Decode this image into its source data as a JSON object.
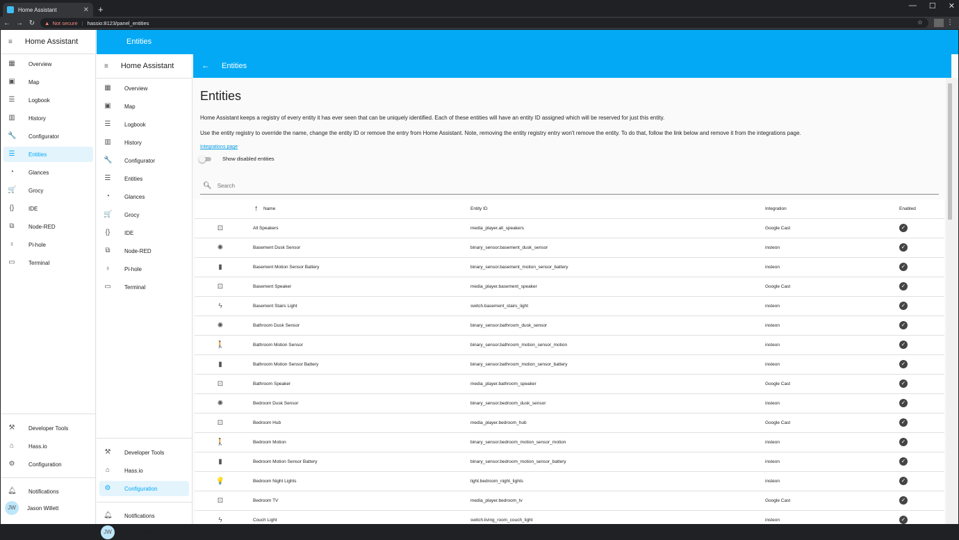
{
  "browser": {
    "tab_title": "Home Assistant",
    "not_secure": "Not secure",
    "url": "hassio:8123/panel_entities"
  },
  "app_name": "Home Assistant",
  "panel_title": "Entities",
  "sidebar": {
    "items": [
      {
        "label": "Overview",
        "icon": "grid-icon",
        "glyph": "▦"
      },
      {
        "label": "Map",
        "icon": "map-icon",
        "glyph": "▣"
      },
      {
        "label": "Logbook",
        "icon": "list-icon",
        "glyph": "☰"
      },
      {
        "label": "History",
        "icon": "chart-icon",
        "glyph": "▥"
      },
      {
        "label": "Configurator",
        "icon": "wrench-icon",
        "glyph": "🔧"
      },
      {
        "label": "Entities",
        "icon": "list-icon",
        "glyph": "☰"
      },
      {
        "label": "Glances",
        "icon": "gauge-icon",
        "glyph": "◔"
      },
      {
        "label": "Grocy",
        "icon": "cart-icon",
        "glyph": "🛒"
      },
      {
        "label": "IDE",
        "icon": "braces-icon",
        "glyph": "{}"
      },
      {
        "label": "Node-RED",
        "icon": "sitemap-icon",
        "glyph": "⧉"
      },
      {
        "label": "Pi-hole",
        "icon": "pihole-icon",
        "glyph": "♁"
      },
      {
        "label": "Terminal",
        "icon": "terminal-icon",
        "glyph": "▭"
      }
    ],
    "bottom": [
      {
        "label": "Developer Tools",
        "icon": "hammer-icon",
        "glyph": "⚒"
      },
      {
        "label": "Hass.io",
        "icon": "hassio-icon",
        "glyph": "⌂"
      },
      {
        "label": "Configuration",
        "icon": "gear-icon",
        "glyph": "⚙"
      }
    ],
    "notifications": "Notifications",
    "user_initials": "JW",
    "user_name": "Jason Willett"
  },
  "page": {
    "title": "Entities",
    "intro": "Home Assistant keeps a registry of every entity it has ever seen that can be uniquely identified. Each of these entities will have an entity ID assigned which will be reserved for just this entity.",
    "intro2": "Use the entity registry to override the name, change the entity ID or remove the entry from Home Assistant. Note, removing the entity registry entry won't remove the entity. To do that, follow the link below and remove it from the integrations page.",
    "link": "Integrations page",
    "toggle_label": "Show disabled entities",
    "search_placeholder": "Search"
  },
  "table": {
    "columns": [
      "Name",
      "Entity ID",
      "Integration",
      "Enabled"
    ],
    "rows": [
      {
        "icon": "cast-icon",
        "glyph": "⊡",
        "name": "All Speakers",
        "id": "media_player.all_speakers",
        "integration": "Google Cast"
      },
      {
        "icon": "brightness-icon",
        "glyph": "✺",
        "name": "Basement Dusk Sensor",
        "id": "binary_sensor.basement_dusk_sensor",
        "integration": "insteon"
      },
      {
        "icon": "battery-icon",
        "glyph": "▮",
        "name": "Basement Motion Sensor Battery",
        "id": "binary_sensor.basement_motion_sensor_battery",
        "integration": "insteon"
      },
      {
        "icon": "cast-icon",
        "glyph": "⊡",
        "name": "Basement Speaker",
        "id": "media_player.basement_speaker",
        "integration": "Google Cast"
      },
      {
        "icon": "flash-icon",
        "glyph": "ϟ",
        "name": "Basement Stairs Light",
        "id": "switch.basement_stairs_light",
        "integration": "insteon"
      },
      {
        "icon": "brightness-icon",
        "glyph": "✺",
        "name": "Bathroom Dusk Sensor",
        "id": "binary_sensor.bathroom_dusk_sensor",
        "integration": "insteon"
      },
      {
        "icon": "walk-icon",
        "glyph": "🚶",
        "name": "Bathroom Motion Sensor",
        "id": "binary_sensor.bathroom_motion_sensor_motion",
        "integration": "insteon"
      },
      {
        "icon": "battery-icon",
        "glyph": "▮",
        "name": "Bathroom Motion Sensor Battery",
        "id": "binary_sensor.bathroom_motion_sensor_battery",
        "integration": "insteon"
      },
      {
        "icon": "cast-icon",
        "glyph": "⊡",
        "name": "Bathroom Speaker",
        "id": "media_player.bathroom_speaker",
        "integration": "Google Cast"
      },
      {
        "icon": "brightness-icon",
        "glyph": "✺",
        "name": "Bedroom Dusk Sensor",
        "id": "binary_sensor.bedroom_dusk_sensor",
        "integration": "insteon"
      },
      {
        "icon": "cast-icon",
        "glyph": "⊡",
        "name": "Bedroom Hub",
        "id": "media_player.bedroom_hub",
        "integration": "Google Cast"
      },
      {
        "icon": "walk-icon",
        "glyph": "🚶",
        "name": "Bedroom Motion",
        "id": "binary_sensor.bedroom_motion_sensor_motion",
        "integration": "insteon"
      },
      {
        "icon": "battery-icon",
        "glyph": "▮",
        "name": "Bedroom Motion Sensor Battery",
        "id": "binary_sensor.bedroom_motion_sensor_battery",
        "integration": "insteon"
      },
      {
        "icon": "bulb-icon",
        "glyph": "💡",
        "name": "Bedroom Night Lights",
        "id": "light.bedroom_night_lights",
        "integration": "insteon"
      },
      {
        "icon": "cast-icon",
        "glyph": "⊡",
        "name": "Bedroom TV",
        "id": "media_player.bedroom_tv",
        "integration": "Google Cast"
      },
      {
        "icon": "flash-icon",
        "glyph": "ϟ",
        "name": "Couch Light",
        "id": "switch.living_room_couch_light",
        "integration": "insteon"
      }
    ]
  },
  "colors": {
    "accent": "#03a9f4",
    "active_bg": "#e3f4fd"
  }
}
